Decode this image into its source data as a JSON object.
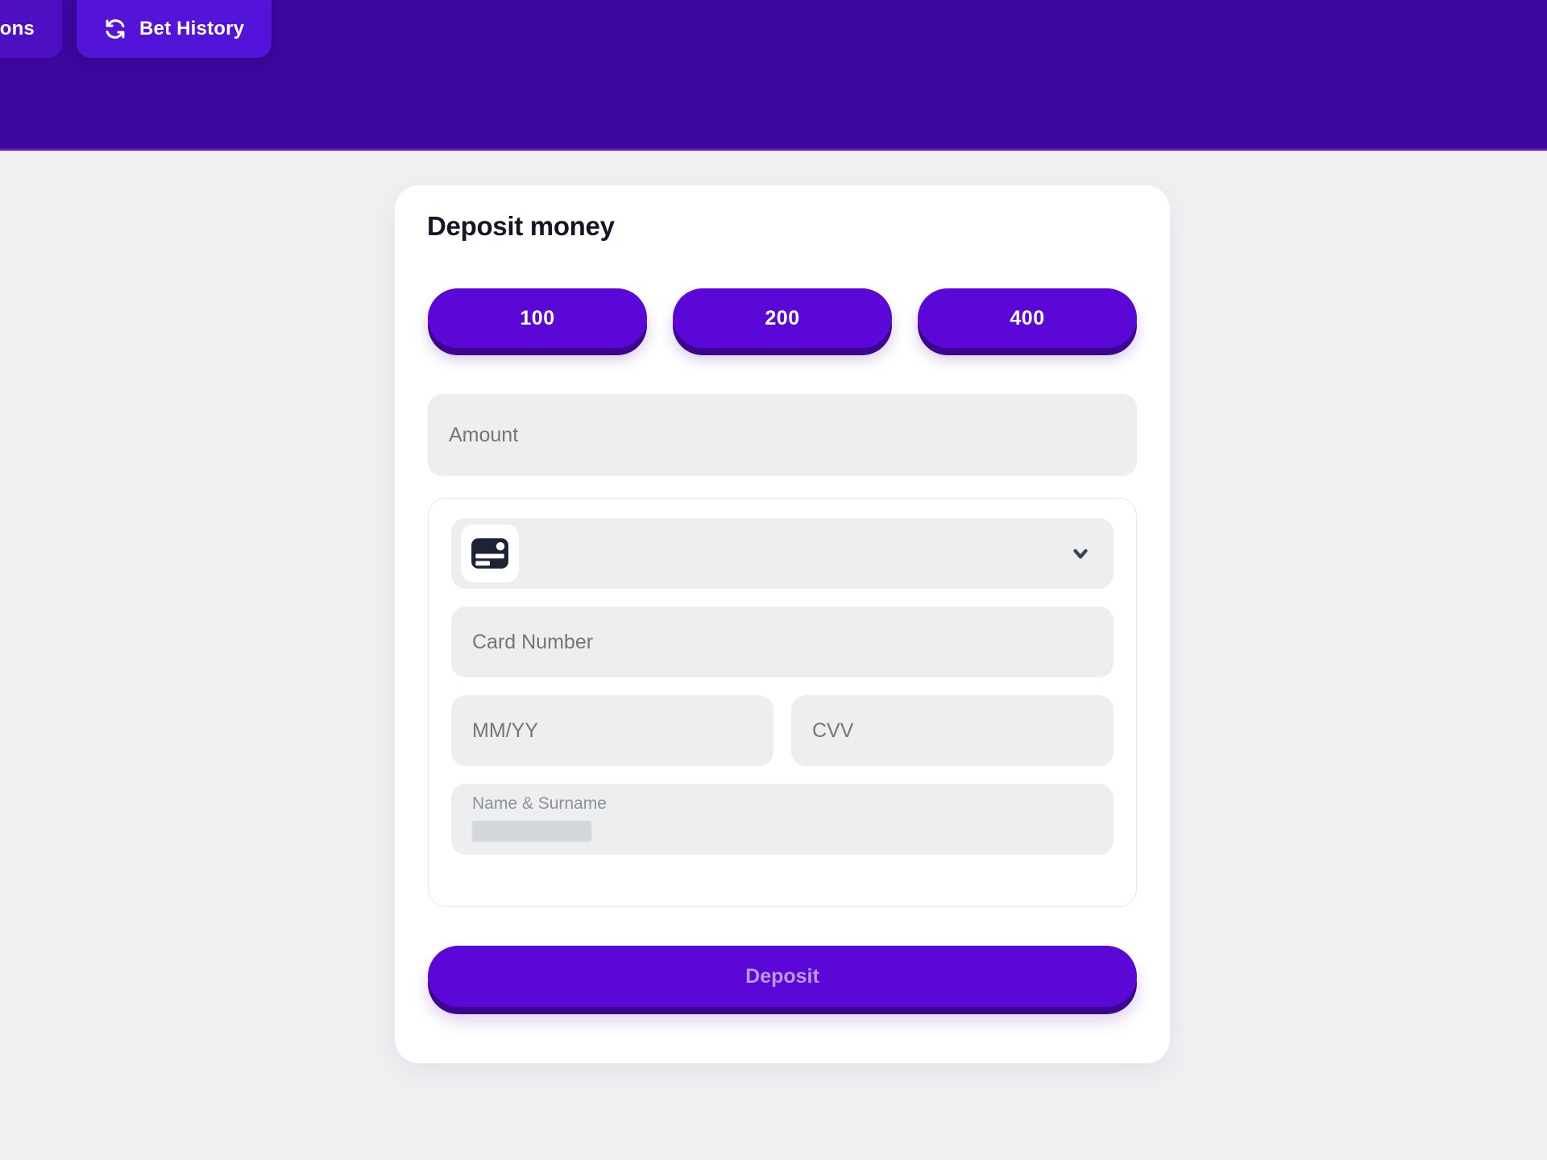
{
  "header": {
    "background_color": "#3d069e",
    "tabs": [
      {
        "label": "sactions",
        "icon": "",
        "active": false
      },
      {
        "label": "Bet History",
        "icon": "refresh-icon",
        "active": true
      }
    ]
  },
  "main": {
    "background_color": "#eef0f2",
    "card": {
      "title": "Deposit money",
      "accent_color": "#5a07d8",
      "quick_amounts": [
        {
          "label": "100",
          "value": 100
        },
        {
          "label": "200",
          "value": 200
        },
        {
          "label": "400",
          "value": 400
        }
      ],
      "amount_input": {
        "placeholder": "Amount",
        "value": ""
      },
      "card_details": {
        "card_type_select": {
          "icon": "credit-card-icon",
          "selected_label": "",
          "chevron": "chevron-down-icon"
        },
        "card_number": {
          "placeholder": "Card Number",
          "value": ""
        },
        "expiry": {
          "placeholder": "MM/YY",
          "value": ""
        },
        "cvv": {
          "placeholder": "CVV",
          "value": ""
        },
        "name_surname": {
          "label": "Name & Surname",
          "value": "",
          "redacted": true
        }
      },
      "submit": {
        "label": "Deposit",
        "text_color": "#b89ae8",
        "enabled": false
      }
    }
  }
}
